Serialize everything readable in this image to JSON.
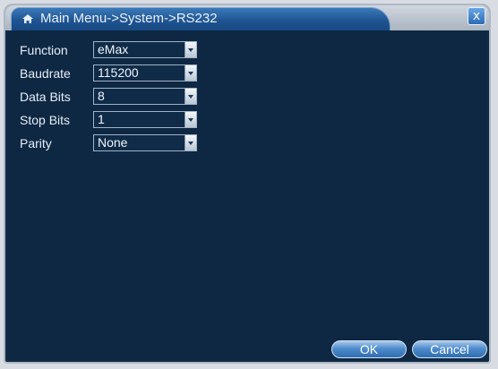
{
  "window": {
    "title": "Main Menu->System->RS232",
    "close_glyph": "x",
    "title_icon": "home-icon",
    "close_icon": "close-icon"
  },
  "fields": [
    {
      "label": "Function",
      "value": "eMax"
    },
    {
      "label": "Baudrate",
      "value": "115200"
    },
    {
      "label": "Data Bits",
      "value": "8"
    },
    {
      "label": "Stop Bits",
      "value": "1"
    },
    {
      "label": "Parity",
      "value": "None"
    }
  ],
  "buttons": {
    "ok_label": "OK",
    "cancel_label": "Cancel"
  },
  "colors": {
    "background": "#0e2843",
    "title_tab": "#1f5592",
    "button": "#4f8ccd"
  }
}
